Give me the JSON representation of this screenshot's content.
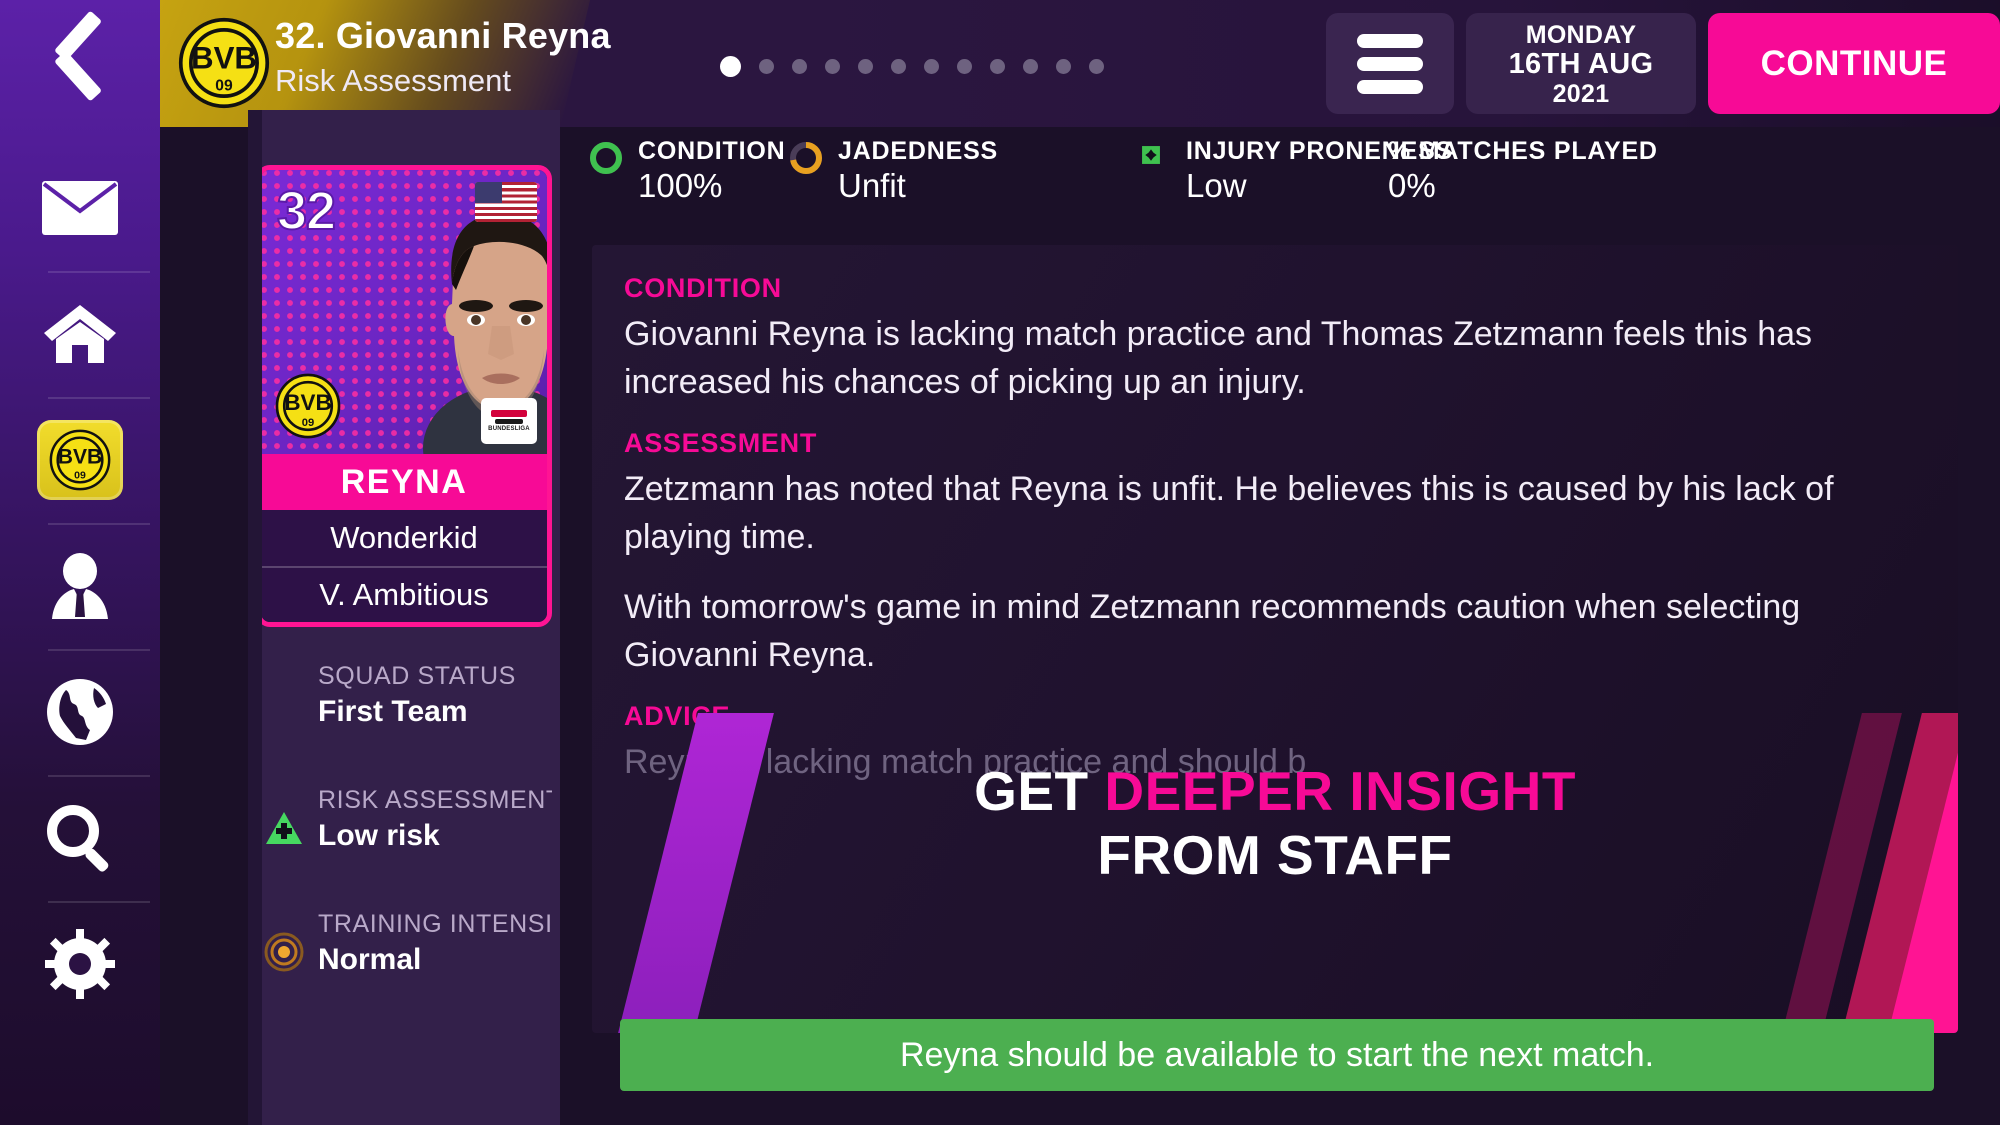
{
  "sidebar": {
    "back_icon": "back-chevron-icon",
    "items": [
      {
        "icon": "inbox-envelope-icon",
        "name": "inbox",
        "active": false
      },
      {
        "icon": "home-icon",
        "name": "home",
        "active": false
      },
      {
        "icon": "club-badge-bvb-icon",
        "name": "club",
        "active": true
      },
      {
        "icon": "manager-person-icon",
        "name": "manager",
        "active": false
      },
      {
        "icon": "world-globe-icon",
        "name": "world",
        "active": false
      },
      {
        "icon": "search-magnifier-icon",
        "name": "search",
        "active": false
      },
      {
        "icon": "settings-gear-icon",
        "name": "settings",
        "active": false
      }
    ]
  },
  "header": {
    "club_badge": "club-badge-bvb-icon",
    "title": "32. Giovanni Reyna",
    "subtitle": "Risk Assessment",
    "page_dots_total": 12,
    "page_dot_active_index": 0,
    "menu_icon": "hamburger-menu-icon",
    "date": {
      "weekday": "MONDAY",
      "day_month": "16TH AUG",
      "year": "2021"
    },
    "continue_label": "CONTINUE"
  },
  "stats": [
    {
      "label": "CONDITION",
      "value": "100%",
      "icon": "condition-ring-icon",
      "color": "#3fc14f",
      "ring_fill": 100
    },
    {
      "label": "JADEDNESS",
      "value": "Unfit",
      "icon": "jadedness-ring-icon",
      "color": "#e8a020",
      "ring_fill": 72
    },
    {
      "label": "INJURY PRONENESS",
      "value": "Low",
      "icon": "injury-proneness-icon",
      "color": "#3fc14f",
      "ring_fill": 0
    },
    {
      "label": "% MATCHES PLAYED",
      "value": "0%",
      "icon": "",
      "color": "#ffffff",
      "ring_fill": 0
    }
  ],
  "player_card": {
    "squad_number": "32",
    "nationality_flag": "usa-flag-icon",
    "club_badge": "club-badge-bvb-icon",
    "league_badge": "bundesliga-badge-icon",
    "surname": "REYNA",
    "traits": [
      "Wonderkid",
      "V. Ambitious"
    ],
    "accent": "#f70a96"
  },
  "player_info": [
    {
      "label": "SQUAD STATUS",
      "value": "First Team",
      "icon": ""
    },
    {
      "label": "RISK ASSESSMENT",
      "value": "Low risk",
      "icon": "risk-low-triangle-icon"
    },
    {
      "label": "TRAINING INTENSI..",
      "value": "Normal",
      "icon": "training-intensity-target-icon"
    }
  ],
  "report": {
    "condition_heading": "CONDITION",
    "condition_body": "Giovanni Reyna is lacking match practice and Thomas Zetzmann feels this has increased his chances of picking up an injury.",
    "assessment_heading": "ASSESSMENT",
    "assessment_body": "Zetzmann has noted that Reyna is unfit. He believes this is caused by his lack of playing time.",
    "assessment_body_2": "With tomorrow's game in mind Zetzmann recommends caution when selecting Giovanni Reyna.",
    "advice_heading": "ADVICE",
    "advice_body": "Reyna is lacking match practice and should b"
  },
  "promo": {
    "line1_white": "GET ",
    "line1_pink": "DEEPER INSIGHT",
    "line2": "FROM STAFF"
  },
  "status": {
    "message": "Reyna should be available to start the next match.",
    "color": "#4caf50"
  }
}
